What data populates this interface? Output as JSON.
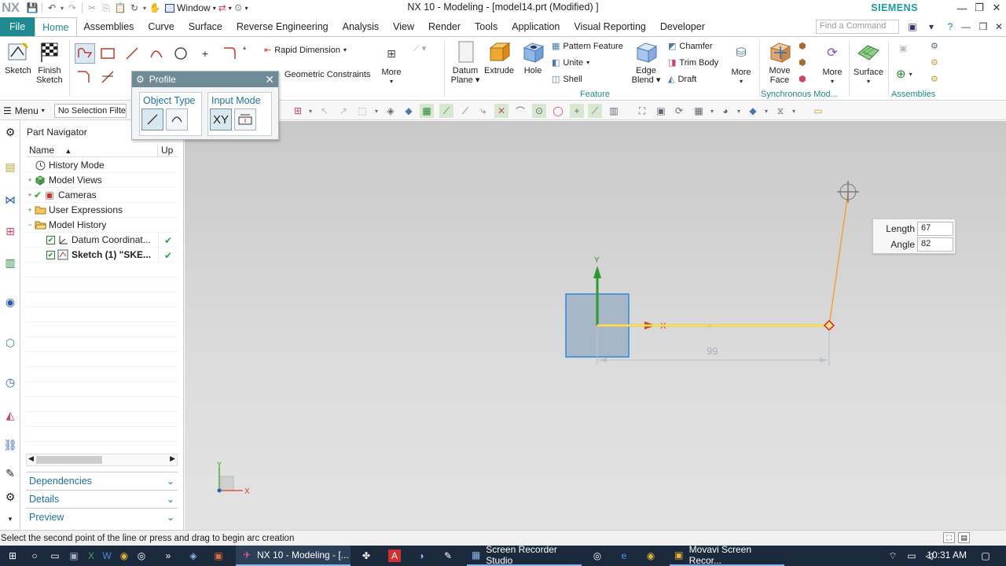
{
  "title_bar": {
    "logo": "NX",
    "window_menu": "Window",
    "title": "NX 10 - Modeling - [model14.prt (Modified) ]",
    "brand": "SIEMENS"
  },
  "tabs": [
    "File",
    "Home",
    "Assemblies",
    "Curve",
    "Surface",
    "Reverse Engineering",
    "Analysis",
    "View",
    "Render",
    "Tools",
    "Application",
    "Visual Reporting",
    "Developer"
  ],
  "active_tab": "Home",
  "command_search": {
    "placeholder": "Find a Command"
  },
  "ribbon": {
    "sketch": "Sketch",
    "finish_sketch_1": "Finish",
    "finish_sketch_2": "Sketch",
    "rapid_dimension": "Rapid Dimension",
    "geometric_constraints": "Geometric Constraints",
    "more_1": "More",
    "datum_plane_1": "Datum",
    "datum_plane_2": "Plane",
    "extrude": "Extrude",
    "hole": "Hole",
    "pattern_feature": "Pattern Feature",
    "unite": "Unite",
    "shell": "Shell",
    "edge_blend_1": "Edge",
    "edge_blend_2": "Blend",
    "chamfer": "Chamfer",
    "trim_body": "Trim Body",
    "draft": "Draft",
    "more_2": "More",
    "move_face_1": "Move",
    "move_face_2": "Face",
    "more_3": "More",
    "surface": "Surface",
    "group_feature": "Feature",
    "group_sync": "Synchronous Mod...",
    "group_assemblies": "Assemblies"
  },
  "selection_bar": {
    "menu": "Menu",
    "filter": "No Selection Filter"
  },
  "part_navigator": {
    "title": "Part Navigator",
    "col_name": "Name",
    "col_up": "Up",
    "rows": [
      {
        "label": "History Mode",
        "indent": 0,
        "expander": "",
        "bold": false,
        "check": false,
        "up": ""
      },
      {
        "label": "Model Views",
        "indent": 0,
        "expander": "+",
        "bold": false,
        "check": false,
        "up": ""
      },
      {
        "label": "Cameras",
        "indent": 0,
        "expander": "+",
        "bold": false,
        "check": true,
        "up": ""
      },
      {
        "label": "User Expressions",
        "indent": 0,
        "expander": "+",
        "bold": false,
        "check": false,
        "up": ""
      },
      {
        "label": "Model History",
        "indent": 0,
        "expander": "−",
        "bold": false,
        "check": false,
        "up": ""
      },
      {
        "label": "Datum Coordinat...",
        "indent": 1,
        "expander": "",
        "bold": false,
        "check": true,
        "up": "✔"
      },
      {
        "label": "Sketch (1) \"SKE...",
        "indent": 1,
        "expander": "",
        "bold": true,
        "check": true,
        "up": "✔"
      }
    ],
    "sections": [
      "Dependencies",
      "Details",
      "Preview"
    ]
  },
  "profile_dialog": {
    "title": "Profile",
    "object_type": "Object Type",
    "input_mode": "Input Mode",
    "xy_label": "XY"
  },
  "sketch": {
    "dimension": "99",
    "length_label": "Length",
    "length_value": "67",
    "angle_label": "Angle",
    "angle_value": "82",
    "axis_y": "Y",
    "axis_x": "X"
  },
  "status": "Select the second point of the line or press and drag to begin arc creation",
  "taskbar": {
    "items": [
      "NX 10 - Modeling - [...",
      "Screen Recorder Studio",
      "Movavi Screen Recor..."
    ],
    "time": "10:31 AM"
  },
  "colors": {
    "accent": "#1f8a8f",
    "sketch_line": "#f5c518",
    "rubber_line": "#f0a040",
    "sketch_point": "#e02020"
  }
}
